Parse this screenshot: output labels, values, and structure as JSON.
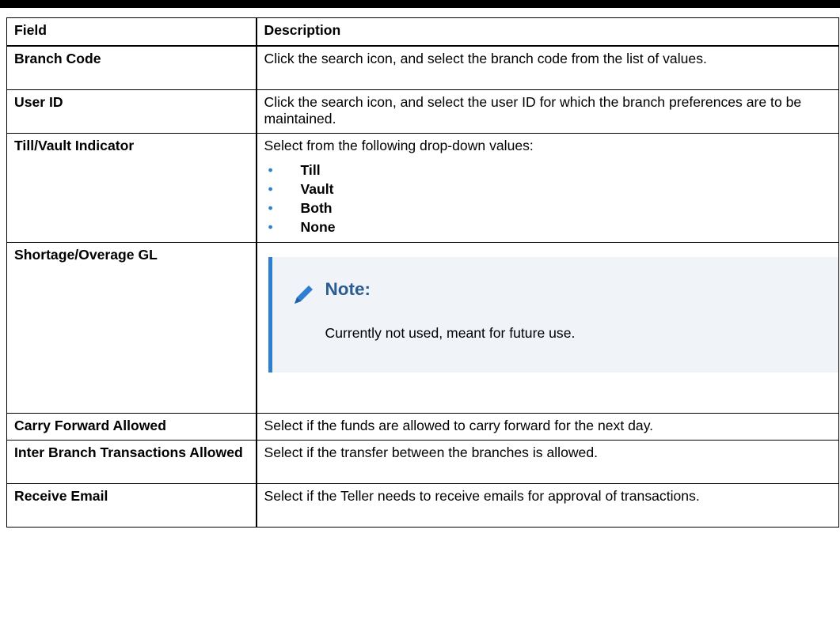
{
  "table": {
    "headers": [
      "Field",
      "Description"
    ],
    "rows": [
      {
        "field": "Branch Code",
        "description": "Click the search icon, and select the branch code from the list of values."
      },
      {
        "field": "User ID",
        "description": "Click the search icon, and select the user ID for which the branch preferences are to be maintained."
      },
      {
        "field": "Till/Vault Indicator",
        "description": "Select from the following drop-down values:",
        "options": [
          "Till",
          "Vault",
          "Both",
          "None"
        ]
      },
      {
        "field": "Shortage/Overage GL",
        "note": {
          "title": "Note:",
          "body": "Currently not used, meant for future use."
        }
      },
      {
        "field": "Carry Forward Allowed",
        "description": "Select if the funds are allowed to carry forward for the next day."
      },
      {
        "field": "Inter Branch Transactions Allowed",
        "description": "Select if the transfer between the branches is allowed."
      },
      {
        "field": "Receive Email",
        "description": "Select if the Teller needs to receive emails for approval of transactions."
      }
    ]
  },
  "colors": {
    "accent": "#2f7fd1",
    "note_title": "#2b5d92",
    "note_bg": "#f0f4f9"
  }
}
